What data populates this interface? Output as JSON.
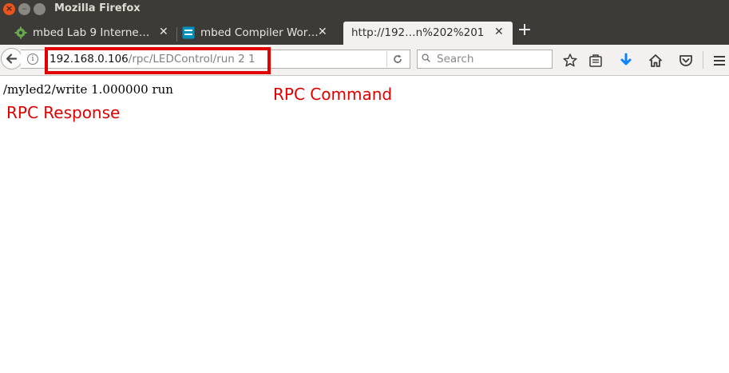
{
  "window": {
    "title": "Mozilla Firefox"
  },
  "tabs": [
    {
      "label": "mbed Lab 9 Interne…",
      "icon": "gear-favicon-icon",
      "active": false
    },
    {
      "label": "mbed Compiler Wor…",
      "icon": "arm-mbed-favicon-icon",
      "active": false
    },
    {
      "label": "http://192…n%202%201",
      "icon": "",
      "active": true
    }
  ],
  "urlbar": {
    "host": "192.168.0.106",
    "path": "/rpc/LEDControl/run 2 1"
  },
  "search": {
    "placeholder": "Search"
  },
  "page": {
    "body_text": "/myled2/write 1.000000 run"
  },
  "annotations": {
    "command_label": "RPC Command",
    "response_label": "RPC Response",
    "color": "#e00000"
  },
  "colors": {
    "titlebar": "#3c3b37",
    "toolbar": "#f2f1f0",
    "download_arrow": "#0a84ff",
    "close_button": "#e95420"
  }
}
